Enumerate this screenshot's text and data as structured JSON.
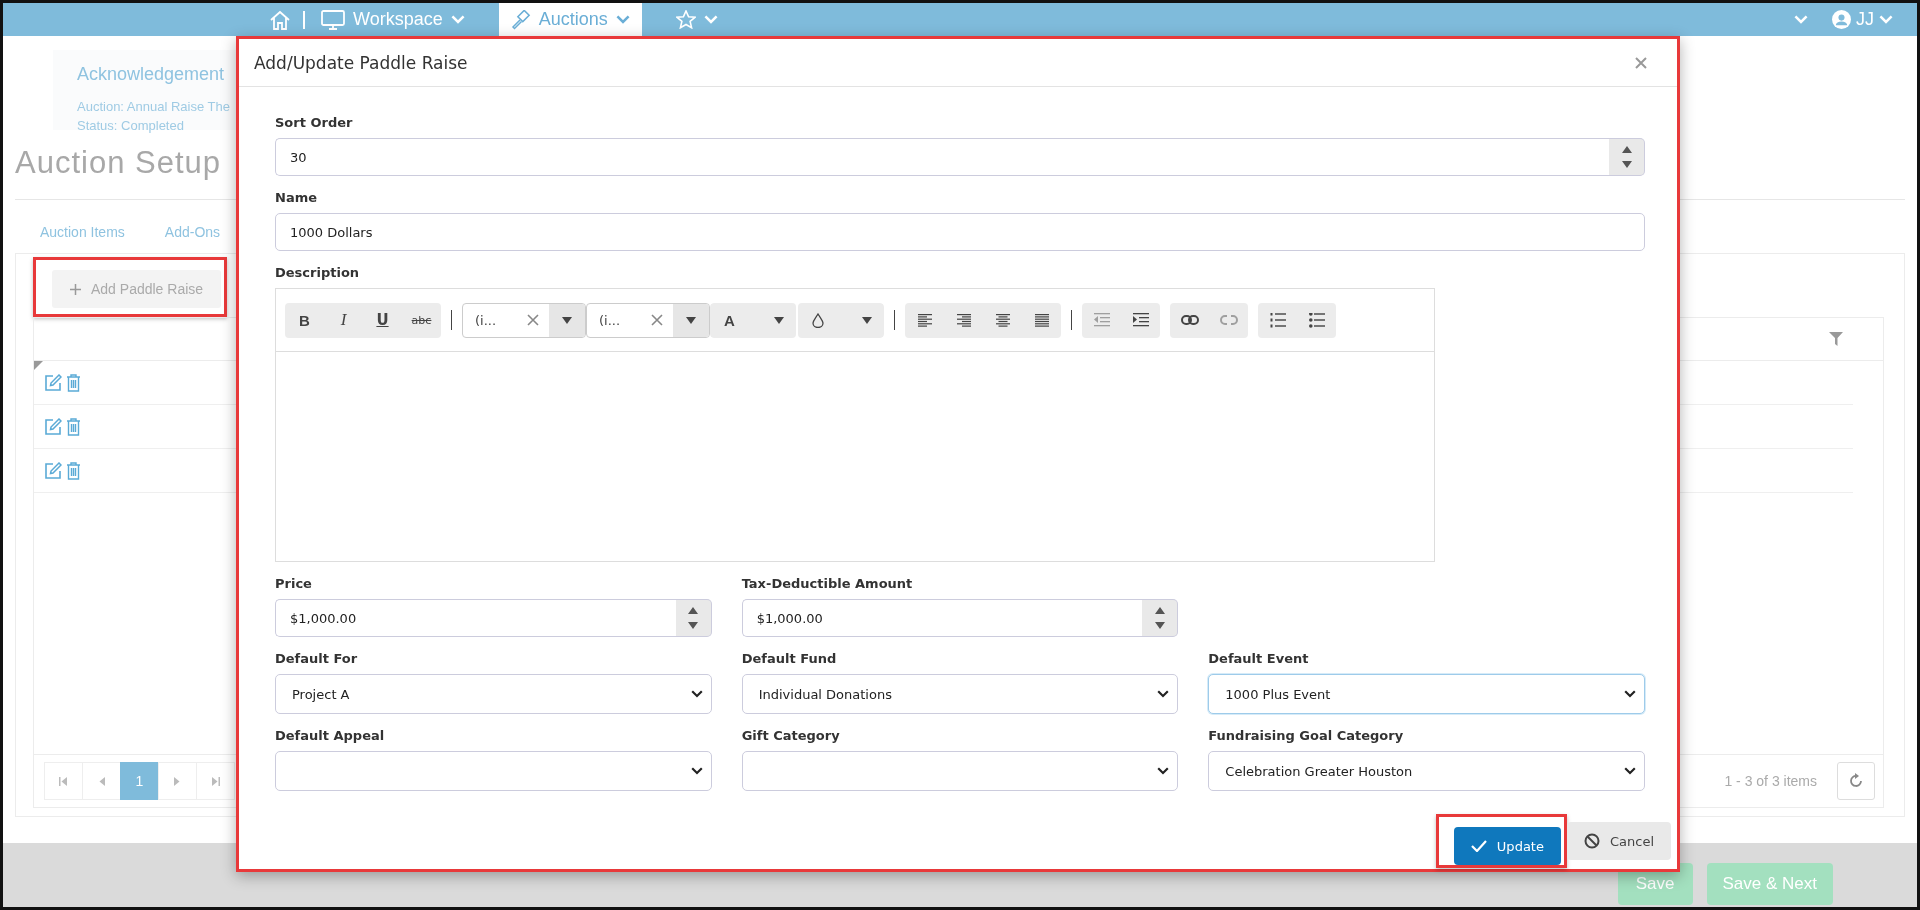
{
  "top_nav": {
    "items": [
      {
        "kind": "home",
        "selected": false
      },
      {
        "kind": "workspace",
        "label": "Workspace",
        "selected": false
      },
      {
        "kind": "auctions",
        "label": "Auctions",
        "selected": true
      },
      {
        "kind": "favorites",
        "selected": false
      }
    ],
    "user": {
      "initials": "JJ"
    }
  },
  "page": {
    "info_card": {
      "title": "Acknowledgement",
      "lines": [
        "Auction: Annual Raise The",
        "Status: Completed"
      ]
    },
    "heading": "Auction Setup",
    "tabs": [
      {
        "label": "Auction Items",
        "selected": false
      },
      {
        "label": "Add-Ons",
        "selected": false
      }
    ],
    "add_button": {
      "label": "Add Paddle Raise",
      "highlighted": true
    },
    "rows": [
      {
        "marked": true
      },
      {
        "marked": false
      },
      {
        "marked": false
      }
    ],
    "pager": {
      "nav": [
        {
          "kind": "first"
        },
        {
          "kind": "prev"
        },
        {
          "kind": "next"
        },
        {
          "kind": "last"
        }
      ],
      "pages": [
        {
          "label": "1",
          "selected": true
        }
      ],
      "summary": "1 - 3 of 3 items"
    }
  },
  "footer": {
    "buttons": [
      {
        "label": "Save"
      },
      {
        "label": "Save & Next"
      }
    ]
  },
  "modal": {
    "title": "Add/Update Paddle Raise",
    "highlighted": true,
    "rows": [
      [
        {
          "label": "Sort Order",
          "kind": "number",
          "value": "30"
        }
      ],
      [
        {
          "label": "Name",
          "kind": "text",
          "value": "1000 Dollars"
        }
      ],
      [
        {
          "label": "Description",
          "kind": "editor"
        }
      ],
      [
        {
          "label": "Price",
          "kind": "number",
          "value": "$1,000.00"
        },
        {
          "label": "Tax-Deductible Amount",
          "kind": "number",
          "value": "$1,000.00"
        }
      ],
      [
        {
          "label": "Default For",
          "kind": "select",
          "value": "Project A",
          "focused": false
        },
        {
          "label": "Default Fund",
          "kind": "select",
          "value": "Individual Donations",
          "focused": false
        },
        {
          "label": "Default Event",
          "kind": "select",
          "value": "1000 Plus Event",
          "focused": true
        }
      ],
      [
        {
          "label": "Default Appeal",
          "kind": "select",
          "focused": false
        },
        {
          "label": "Gift Category",
          "kind": "select",
          "focused": false
        },
        {
          "label": "Fundraising Goal Category",
          "kind": "select",
          "value": "Celebration Greater Houston",
          "focused": false
        }
      ]
    ],
    "toolbar": [
      {
        "kind": "buttons",
        "tools": [
          {
            "kind": "bold",
            "label": "B",
            "disabled": false
          },
          {
            "kind": "italic",
            "label": "I",
            "disabled": false
          },
          {
            "kind": "underline",
            "label": "U",
            "disabled": false
          },
          {
            "kind": "strike",
            "label": "abc",
            "disabled": false
          }
        ]
      },
      {
        "kind": "separator"
      },
      {
        "kind": "combo",
        "value": "(i..."
      },
      {
        "kind": "combo",
        "value": "(i..."
      },
      {
        "kind": "pickers",
        "tools": [
          {
            "kind": "font-color",
            "label": "A",
            "disabled": false
          },
          {
            "kind": "droplet",
            "disabled": false
          }
        ]
      },
      {
        "kind": "separator"
      },
      {
        "kind": "buttons",
        "tools": [
          {
            "kind": "align-left",
            "disabled": false
          },
          {
            "kind": "align-right",
            "disabled": false
          },
          {
            "kind": "align-center",
            "disabled": false
          },
          {
            "kind": "justify",
            "disabled": false
          }
        ]
      },
      {
        "kind": "separator"
      },
      {
        "kind": "buttons",
        "tools": [
          {
            "kind": "outdent",
            "disabled": true
          },
          {
            "kind": "indent",
            "disabled": false
          }
        ]
      },
      {
        "kind": "buttons",
        "tools": [
          {
            "kind": "link",
            "disabled": false
          },
          {
            "kind": "unlink",
            "disabled": true
          }
        ]
      },
      {
        "kind": "buttons",
        "tools": [
          {
            "kind": "ordered-list",
            "disabled": false
          },
          {
            "kind": "bullet-list",
            "disabled": false
          }
        ]
      }
    ],
    "buttons": [
      {
        "label": "Update",
        "kind": "primary",
        "highlighted": true
      },
      {
        "label": "Cancel",
        "kind": "secondary",
        "highlighted": false
      }
    ]
  }
}
